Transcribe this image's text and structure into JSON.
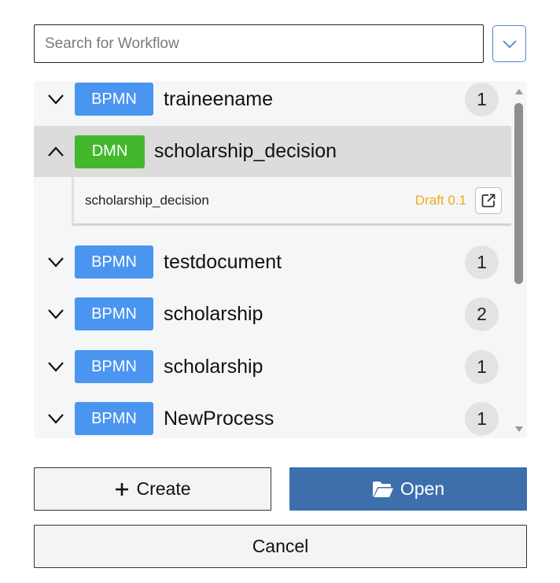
{
  "search": {
    "placeholder": "Search for Workflow",
    "value": ""
  },
  "dropdown": {
    "icon": "chevron-down-icon"
  },
  "workflows": [
    {
      "type": "BPMN",
      "name": "traineename",
      "count": "1",
      "expanded": false
    },
    {
      "type": "DMN",
      "name": "scholarship_decision",
      "count": "",
      "expanded": true,
      "versions": [
        {
          "name": "scholarship_decision",
          "status": "Draft 0.1"
        }
      ]
    },
    {
      "type": "BPMN",
      "name": "testdocument",
      "count": "1",
      "expanded": false
    },
    {
      "type": "BPMN",
      "name": "scholarship",
      "count": "2",
      "expanded": false
    },
    {
      "type": "BPMN",
      "name": "scholarship",
      "count": "1",
      "expanded": false
    },
    {
      "type": "BPMN",
      "name": "NewProcess",
      "count": "1",
      "expanded": false
    }
  ],
  "colors": {
    "bpmn_badge": "#4a95f0",
    "dmn_badge": "#43b82d",
    "draft_status": "#f2a81d",
    "open_button": "#3d6fac"
  },
  "buttons": {
    "create": {
      "label": "Create",
      "icon": "plus-icon"
    },
    "open": {
      "label": "Open",
      "icon": "folder-open-icon"
    },
    "cancel": {
      "label": "Cancel"
    }
  }
}
